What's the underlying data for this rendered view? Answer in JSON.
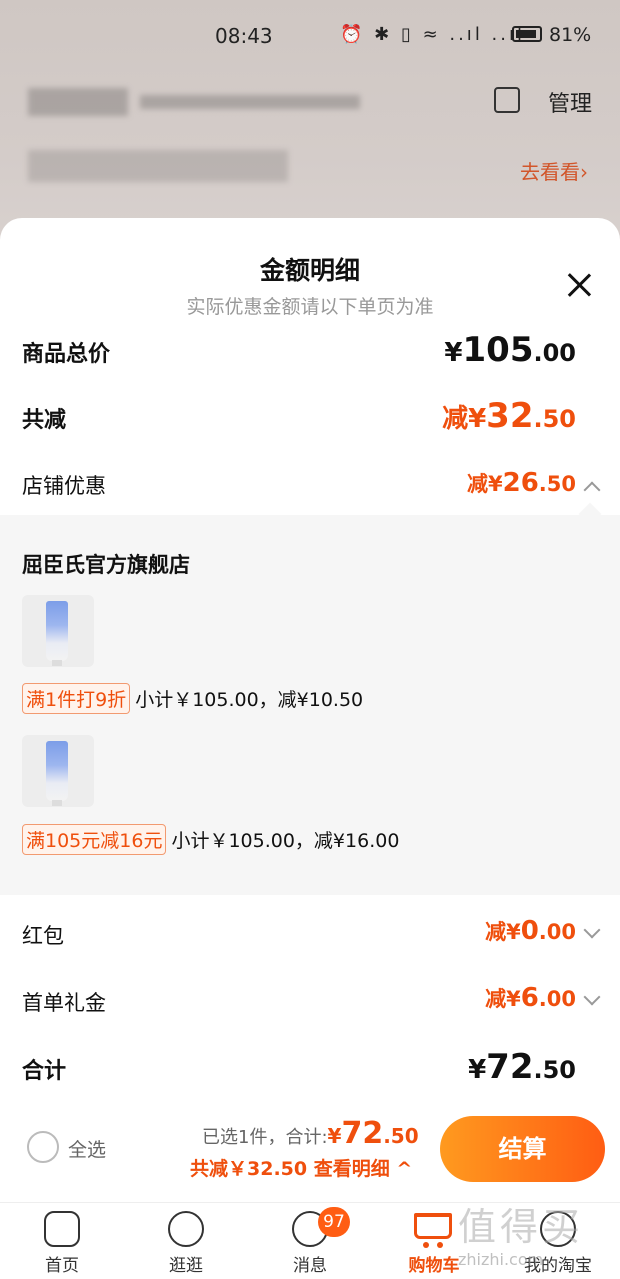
{
  "status_bar": {
    "time": "08:43",
    "icons": "⏰ ✱ ▯ ≈ ..ıl ..ıl",
    "battery_pct": "81%"
  },
  "background": {
    "manage": "管理",
    "go_see": "去看看›"
  },
  "sheet": {
    "title": "金额明细",
    "subtitle": "实际优惠金额请以下单页为准",
    "rows": {
      "goods_total": {
        "label": "商品总价",
        "currency": "¥",
        "int": "105",
        "dec": ".00"
      },
      "total_reduction": {
        "label": "共减",
        "prefix": "减¥",
        "int": "32",
        "dec": ".50"
      },
      "store_discount": {
        "label": "店铺优惠",
        "prefix": "减¥",
        "int": "26",
        "dec": ".50"
      },
      "red_packet": {
        "label": "红包",
        "prefix": "减¥",
        "int": "0",
        "dec": ".00"
      },
      "first_order_gift": {
        "label": "首单礼金",
        "prefix": "减¥",
        "int": "6",
        "dec": ".00"
      },
      "grand_total": {
        "label": "合计",
        "currency": "¥",
        "int": "72",
        "dec": ".50"
      }
    },
    "store": {
      "name": "屈臣氏官方旗舰店",
      "items": [
        {
          "promo_tag": "满1件打9折",
          "promo_text": "小计￥105.00，减¥10.50"
        },
        {
          "promo_tag": "满105元减16元",
          "promo_text": "小计￥105.00，减¥16.00"
        }
      ]
    }
  },
  "checkout": {
    "select_all": "全选",
    "selected_prefix": "已选1件，合计:",
    "total_currency": "¥",
    "total_int": "72",
    "total_dec": ".50",
    "reduction_line": "共减￥32.50 查看明细 ^",
    "button": "结算"
  },
  "nav": {
    "items": [
      {
        "label": "首页"
      },
      {
        "label": "逛逛"
      },
      {
        "label": "消息"
      },
      {
        "label": "购物车"
      },
      {
        "label": "我的淘宝"
      }
    ],
    "message_badge": "97"
  },
  "watermark": {
    "text": "值得买",
    "url": "zhizhi.com"
  },
  "colors": {
    "accent": "#ef4f0d",
    "button_start": "#ff9a1f",
    "button_end": "#ff5d13"
  }
}
